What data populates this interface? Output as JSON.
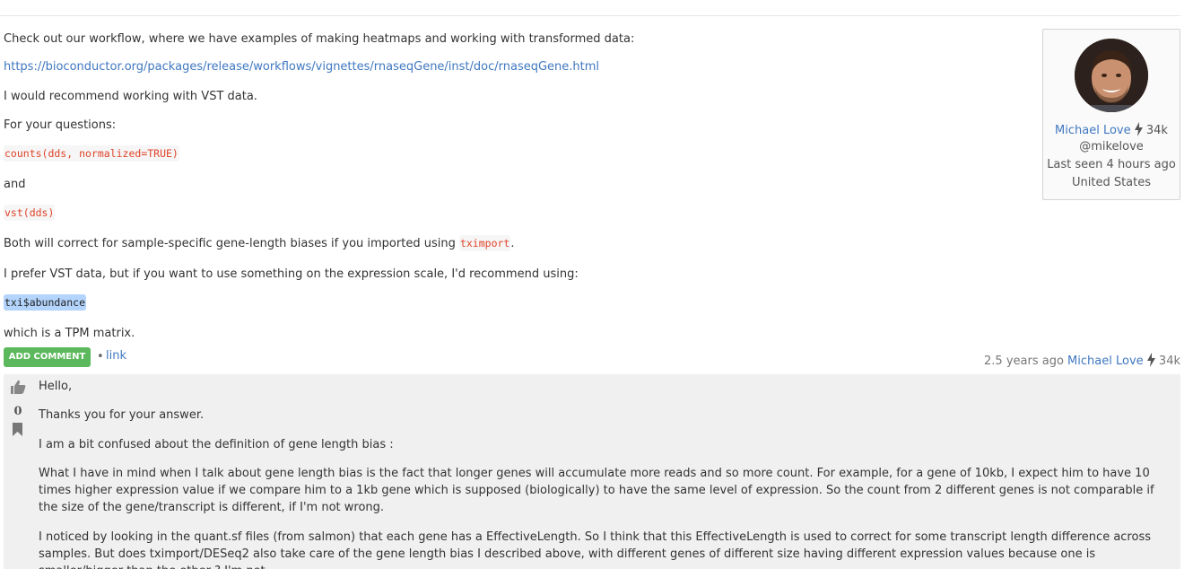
{
  "answer": {
    "intro": "Check out our workflow, where we have examples of making heatmaps and working with transformed data:",
    "workflow_link": "https://bioconductor.org/packages/release/workflows/vignettes/rnaseqGene/inst/doc/rnaseqGene.html",
    "recommend": "I would recommend working with VST data.",
    "questions": "For your questions:",
    "code_counts": "counts(dds, normalized=TRUE)",
    "and": "and",
    "code_vst": "vst(dds)",
    "both_before": "Both will correct for sample-specific gene-length biases if you imported using ",
    "both_code": "tximport",
    "both_after": ".",
    "prefer": "I prefer VST data, but if you want to use something on the expression scale, I'd recommend using:",
    "code_abundance": "txi$abundance",
    "tpm": "which is a TPM matrix."
  },
  "actions": {
    "add_comment": "ADD COMMENT",
    "separator": "•",
    "link": "link"
  },
  "post_meta": {
    "age": "2.5 years ago",
    "author": "Michael Love",
    "reputation": "34k"
  },
  "user_card": {
    "name": "Michael Love",
    "reputation": "34k",
    "handle": "@mikelove",
    "last_seen": "Last seen 4 hours ago",
    "location": "United States"
  },
  "comment": {
    "votes": "0",
    "p1": "Hello,",
    "p2": "Thanks you for your answer.",
    "p3": "I am a bit confused about the definition of gene length bias :",
    "p4": "What I have in mind when I talk about gene length bias is the fact that longer genes will accumulate more reads and so more count. For example, for a gene of 10kb, I expect him to have 10 times higher expression value if we compare him to a 1kb gene which is supposed (biologically) to have the same level of expression. So the count from 2 different genes is not comparable if the size of the gene/transcript is different, if I'm not wrong.",
    "p5": "I noticed by looking in the quant.sf files (from salmon) that each gene has a EffectiveLength. So I think that this EffectiveLength is used to correct for some transcript length difference across samples. But does tximport/DESeq2 also take care of the gene length bias I described above, with different genes of different size having different expression values because one is smaller/bigger than the other ? I'm not"
  },
  "colors": {
    "link": "#4078c0",
    "code": "#e0442a",
    "button": "#5cb85c",
    "comment_bg": "#f0f0f0"
  }
}
